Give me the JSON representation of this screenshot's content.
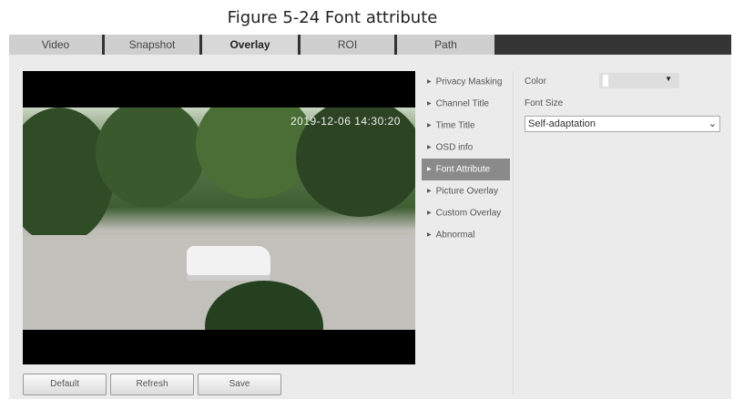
{
  "caption": "Figure 5-24 Font attribute",
  "tabs": [
    {
      "label": "Video"
    },
    {
      "label": "Snapshot"
    },
    {
      "label": "Overlay"
    },
    {
      "label": "ROI"
    },
    {
      "label": "Path"
    }
  ],
  "video": {
    "timestamp": "2019-12-06 14:30:20"
  },
  "menu": [
    {
      "label": "Privacy Masking"
    },
    {
      "label": "Channel Title"
    },
    {
      "label": "Time Title"
    },
    {
      "label": "OSD info"
    },
    {
      "label": "Font Attribute"
    },
    {
      "label": "Picture Overlay"
    },
    {
      "label": "Custom Overlay"
    },
    {
      "label": "Abnormal"
    }
  ],
  "form": {
    "color_label": "Color",
    "font_size_label": "Font Size",
    "font_size_value": "Self-adaptation",
    "color_value": "#ffffff"
  },
  "buttons": {
    "default": "Default",
    "refresh": "Refresh",
    "save": "Save"
  }
}
